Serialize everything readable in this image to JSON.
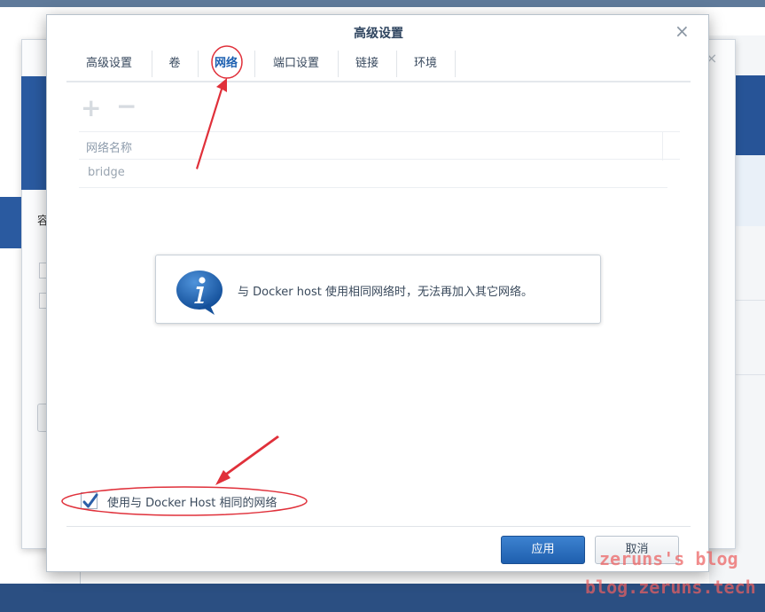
{
  "dialog": {
    "title": "高级设置",
    "close_glyph": "×"
  },
  "tabs": [
    {
      "label": "高级设置"
    },
    {
      "label": "卷"
    },
    {
      "label": "网络",
      "active": true
    },
    {
      "label": "端口设置"
    },
    {
      "label": "链接"
    },
    {
      "label": "环境"
    }
  ],
  "toolbar": {
    "add_glyph": "+",
    "remove_glyph": "−"
  },
  "network_table": {
    "header": "网络名称",
    "rows": [
      {
        "name": "bridge"
      }
    ]
  },
  "info": {
    "icon": "info-icon",
    "message": "与 Docker host 使用相同网络时，无法再加入其它网络。"
  },
  "use_host_network": {
    "label": "使用与 Docker Host 相同的网络",
    "checked": true
  },
  "footer": {
    "apply_label": "应用",
    "cancel_label": "取消"
  },
  "underlying_window": {
    "label_fragment": "容",
    "close_glyph": "×"
  },
  "watermark": {
    "line1": "zeruns's blog",
    "line2": "blog.zeruns.tech"
  },
  "colors": {
    "primary_button": "#1f5fae",
    "annotation_red": "#e0303a",
    "title_text": "#2f4560",
    "active_tab": "#1b5fb0"
  }
}
